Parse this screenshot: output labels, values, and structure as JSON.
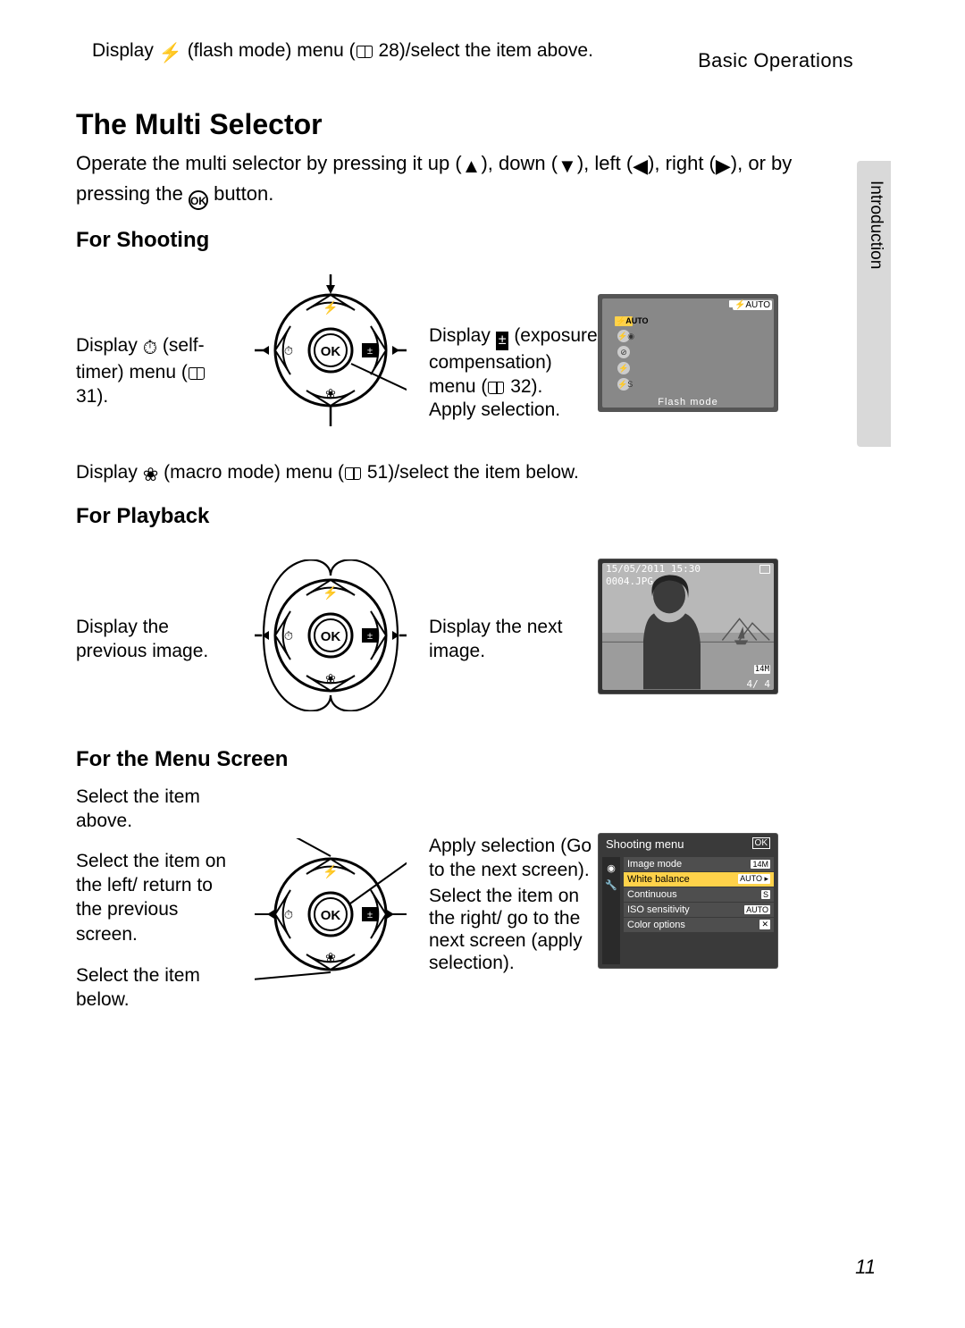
{
  "runningHead": "Basic Operations",
  "thumbTab": "Introduction",
  "title": "The Multi Selector",
  "intro_pre": "Operate the multi selector by pressing it up (",
  "intro_mid1": "), down (",
  "intro_mid2": "), left (",
  "intro_mid3": "), right (",
  "intro_post1": "), or by pressing the ",
  "intro_post2": " button.",
  "okLabel": "OK",
  "shooting": {
    "heading": "For Shooting",
    "up_pre": "Display ",
    "up_mid": " (flash mode) menu (",
    "up_ref": " 28)/select the item above.",
    "left_pre": "Display ",
    "left_mid": " (self-timer) menu (",
    "left_ref": " 31).",
    "right_pre": "Display ",
    "right_mid": " (exposure compensation) menu (",
    "right_ref": " 32).",
    "apply": "Apply selection.",
    "down_pre": "Display ",
    "down_mid": " (macro mode) menu (",
    "down_ref": " 51)/select the item below.",
    "screen": {
      "autoBadge": "⚡AUTO",
      "selectedLabel": "Flash mode"
    }
  },
  "playback": {
    "heading": "For Playback",
    "left": "Display the previous image.",
    "right": "Display the next image.",
    "screen": {
      "date": "15/05/2011  15:30",
      "file": "0004.JPG",
      "count": "4/    4",
      "size": "14M"
    }
  },
  "menu": {
    "heading": "For the Menu Screen",
    "up": "Select the item above.",
    "left": "Select the item on the left/ return to the previous screen.",
    "below": "Select the item below.",
    "apply": "Apply selection (Go to the next screen).",
    "right": "Select the item on the right/ go to the next screen (apply selection).",
    "screen": {
      "title": "Shooting menu",
      "items": [
        {
          "label": "Image mode",
          "value": "14M"
        },
        {
          "label": "White balance",
          "value": "AUTO ▸"
        },
        {
          "label": "Continuous",
          "value": "S"
        },
        {
          "label": "ISO sensitivity",
          "value": "AUTO"
        },
        {
          "label": "Color options",
          "value": "✕"
        }
      ]
    }
  },
  "folio": "11"
}
